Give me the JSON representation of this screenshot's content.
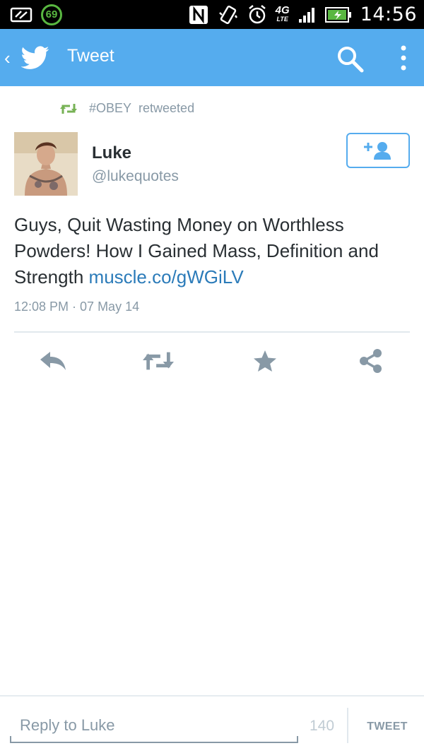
{
  "status_bar": {
    "badge_number": "69",
    "network_label": "4G",
    "network_sub": "LTE",
    "time": "14:56",
    "icons": [
      "notification-icon",
      "nfc-icon",
      "vibrate-icon",
      "alarm-icon",
      "signal-icon",
      "battery-icon"
    ]
  },
  "app_bar": {
    "title": "Tweet",
    "back_icon": "chevron-left-icon",
    "logo_icon": "twitter-bird-icon",
    "search_icon": "search-icon",
    "menu_icon": "more-vert-icon"
  },
  "retweet_header": {
    "icon": "retweet-icon",
    "account": "#OBEY",
    "label": "retweeted"
  },
  "author": {
    "name": "Luke",
    "handle": "@lukequotes",
    "follow_icon": "add-user-icon"
  },
  "tweet": {
    "text": "Guys, Quit Wasting Money on Worthless Powders! How I Gained Mass, Definition and Strength",
    "link": "muscle.co/gWGiLV",
    "timestamp": "12:08 PM · 07 May 14"
  },
  "actions": [
    {
      "name": "reply",
      "icon": "reply-icon"
    },
    {
      "name": "retweet",
      "icon": "retweet-icon"
    },
    {
      "name": "favorite",
      "icon": "star-icon"
    },
    {
      "name": "share",
      "icon": "share-icon"
    }
  ],
  "reply_bar": {
    "placeholder": "Reply to Luke",
    "char_count": "140",
    "submit_label": "TWEET"
  },
  "colors": {
    "brand_blue": "#55acee",
    "retweet_green": "#77b255",
    "link_blue": "#2b7bb9",
    "muted_gray": "#8899a6",
    "status_accent": "#59b741"
  }
}
